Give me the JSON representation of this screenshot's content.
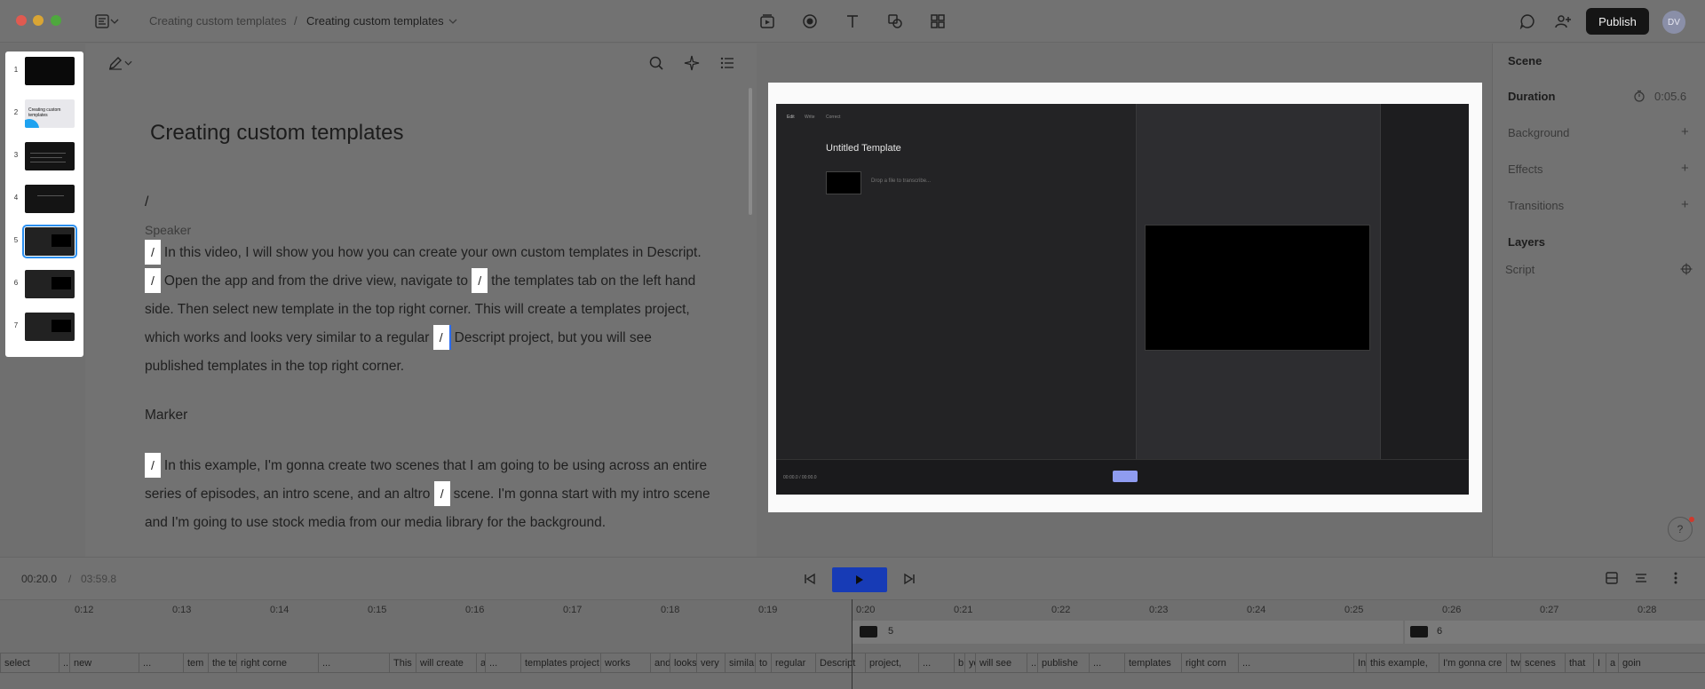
{
  "window": {
    "controls": {
      "close": "#e05a50",
      "minimize": "#d9a534",
      "maximize": "#4ea83d"
    },
    "breadcrumb": {
      "parent": "Creating custom templates",
      "separator": "/",
      "current": "Creating custom templates"
    }
  },
  "toolbar": {
    "icons": [
      "media-icon",
      "record-icon",
      "text-icon",
      "shapes-icon",
      "elements-icon"
    ],
    "publish_label": "Publish",
    "avatar_initials": "DV"
  },
  "scenes": {
    "thumbnails": [
      {
        "num": "1",
        "text": ""
      },
      {
        "num": "2",
        "text": "Creating custom templates"
      },
      {
        "num": "3",
        "text": ""
      },
      {
        "num": "4",
        "text": ""
      },
      {
        "num": "5",
        "text": ""
      },
      {
        "num": "6",
        "text": ""
      },
      {
        "num": "7",
        "text": ""
      }
    ],
    "selected": "5"
  },
  "script": {
    "title": "Creating custom templates",
    "first_slash": "/",
    "speaker": "Speaker",
    "marker_slash": "/",
    "para1_seg1": "In this video, I will show you how you can create your own custom templates in Descript.",
    "para1_seg2": "Open the app and from the drive view, navigate to",
    "para1_seg3": "the templates tab on the left hand side. Then select new template in the top right corner. This will create a templates project, which works and looks very similar to a regular",
    "para1_seg4": "Descript project, but you will see published templates in the top right corner.",
    "marker_heading": "Marker",
    "para2_seg1": "In this example, I'm gonna create two scenes that I am going to be using across an entire series of episodes, an intro scene, and an altro",
    "para2_seg2": "scene. I'm gonna start with my intro scene and I'm going to use stock media from our media library for the background."
  },
  "preview": {
    "menu": [
      "Edit",
      "Write",
      "Correct"
    ],
    "inner_title": "Untitled Template",
    "drop_placeholder": "Drop a file to transcribe...",
    "inner_timecode": "00:00.0 / 00:00.0"
  },
  "properties": {
    "scene_heading": "Scene",
    "duration_label": "Duration",
    "duration_value": "0:05.6",
    "background_label": "Background",
    "effects_label": "Effects",
    "transitions_label": "Transitions",
    "layers_heading": "Layers",
    "script_layer": "Script",
    "help_label": "?"
  },
  "transport": {
    "current_time": "00:20.0",
    "separator": "/",
    "total_time": "03:59.8"
  },
  "timeline": {
    "ticks": [
      "0:12",
      "0:13",
      "0:14",
      "0:15",
      "0:16",
      "0:17",
      "0:18",
      "0:19",
      "0:20",
      "0:21",
      "0:22",
      "0:23",
      "0:24",
      "0:25",
      "0:26",
      "0:27",
      "0:28"
    ],
    "scene5_label": "5",
    "scene6_label": "6",
    "words": [
      "select",
      "...",
      "new",
      "...",
      "tem",
      "the te",
      "right corne",
      "...",
      "This",
      "will create",
      "a",
      "...",
      "templates project",
      "works",
      "and",
      "looks",
      "very",
      "simila",
      "to",
      "regular",
      "Descript",
      "project,",
      "...",
      "b",
      "yo",
      "will see",
      "...",
      "publishe",
      "...",
      "templates",
      "right corn",
      "...",
      "In",
      "this example,",
      "I'm gonna cre",
      "tw",
      "scenes",
      "that",
      "I",
      "a",
      "goin"
    ]
  }
}
